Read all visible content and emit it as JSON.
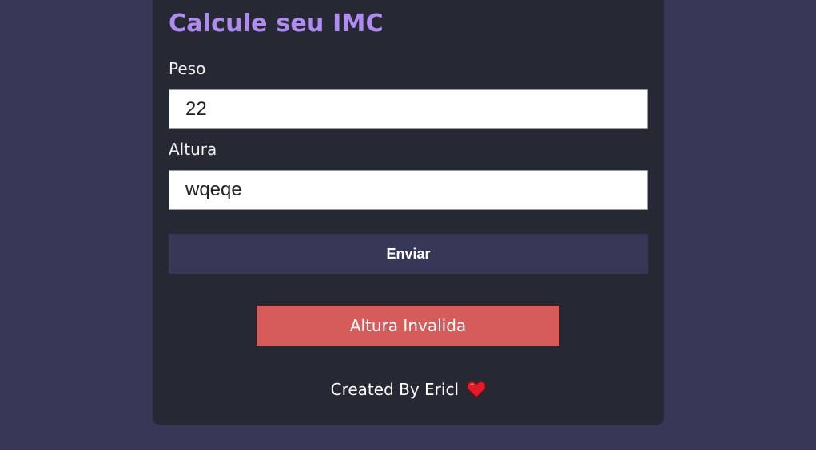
{
  "title": "Calcule seu IMC",
  "form": {
    "peso_label": "Peso",
    "peso_value": "22",
    "altura_label": "Altura",
    "altura_value": "wqeqe",
    "submit_label": "Enviar"
  },
  "result": {
    "error_text": "Altura Invalida",
    "error_color": "#d65c5c"
  },
  "footer": {
    "text": "Created By Ericl",
    "icon": "heart-icon"
  },
  "colors": {
    "background": "#373757",
    "card": "#262834",
    "title": "#b18cf0",
    "button": "#373757"
  }
}
